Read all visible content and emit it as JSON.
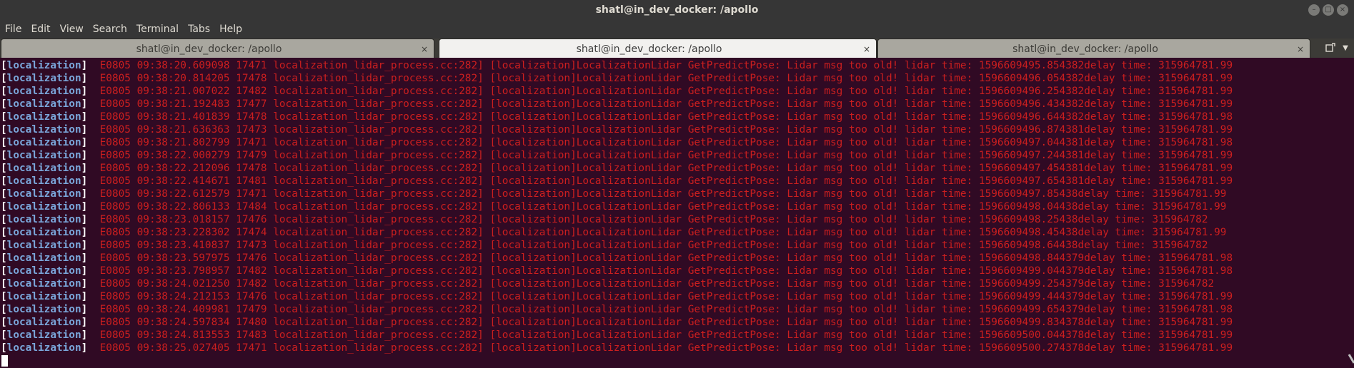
{
  "window": {
    "title": "shatl@in_dev_docker: /apollo",
    "buttons": [
      "minimize-button",
      "maximize-button",
      "close-button"
    ]
  },
  "menu": [
    "File",
    "Edit",
    "View",
    "Search",
    "Terminal",
    "Tabs",
    "Help"
  ],
  "tabs": [
    {
      "label": "shatl@in_dev_docker: /apollo",
      "close": "×",
      "active": false
    },
    {
      "label": "shatl@in_dev_docker: /apollo",
      "close": "×",
      "active": true
    },
    {
      "label": "shatl@in_dev_docker: /apollo",
      "close": "×",
      "active": false
    }
  ],
  "terminal": {
    "tag": "localization",
    "lines": [
      "E0805 09:38:20.609098 17471 localization_lidar_process.cc:282] [localization]LocalizationLidar GetPredictPose: Lidar msg too old! lidar time: 1596609495.854382delay time: 315964781.99",
      "E0805 09:38:20.814205 17478 localization_lidar_process.cc:282] [localization]LocalizationLidar GetPredictPose: Lidar msg too old! lidar time: 1596609496.054382delay time: 315964781.99",
      "E0805 09:38:21.007022 17482 localization_lidar_process.cc:282] [localization]LocalizationLidar GetPredictPose: Lidar msg too old! lidar time: 1596609496.254382delay time: 315964781.99",
      "E0805 09:38:21.192483 17477 localization_lidar_process.cc:282] [localization]LocalizationLidar GetPredictPose: Lidar msg too old! lidar time: 1596609496.434382delay time: 315964781.99",
      "E0805 09:38:21.401839 17478 localization_lidar_process.cc:282] [localization]LocalizationLidar GetPredictPose: Lidar msg too old! lidar time: 1596609496.644382delay time: 315964781.98",
      "E0805 09:38:21.636363 17473 localization_lidar_process.cc:282] [localization]LocalizationLidar GetPredictPose: Lidar msg too old! lidar time: 1596609496.874381delay time: 315964781.99",
      "E0805 09:38:21.802799 17471 localization_lidar_process.cc:282] [localization]LocalizationLidar GetPredictPose: Lidar msg too old! lidar time: 1596609497.044381delay time: 315964781.98",
      "E0805 09:38:22.000279 17479 localization_lidar_process.cc:282] [localization]LocalizationLidar GetPredictPose: Lidar msg too old! lidar time: 1596609497.244381delay time: 315964781.99",
      "E0805 09:38:22.212096 17478 localization_lidar_process.cc:282] [localization]LocalizationLidar GetPredictPose: Lidar msg too old! lidar time: 1596609497.454381delay time: 315964781.99",
      "E0805 09:38:22.414671 17481 localization_lidar_process.cc:282] [localization]LocalizationLidar GetPredictPose: Lidar msg too old! lidar time: 1596609497.654381delay time: 315964781.99",
      "E0805 09:38:22.612579 17471 localization_lidar_process.cc:282] [localization]LocalizationLidar GetPredictPose: Lidar msg too old! lidar time: 1596609497.85438delay time: 315964781.99",
      "E0805 09:38:22.806133 17484 localization_lidar_process.cc:282] [localization]LocalizationLidar GetPredictPose: Lidar msg too old! lidar time: 1596609498.04438delay time: 315964781.99",
      "E0805 09:38:23.018157 17476 localization_lidar_process.cc:282] [localization]LocalizationLidar GetPredictPose: Lidar msg too old! lidar time: 1596609498.25438delay time: 315964782",
      "E0805 09:38:23.228302 17474 localization_lidar_process.cc:282] [localization]LocalizationLidar GetPredictPose: Lidar msg too old! lidar time: 1596609498.45438delay time: 315964781.99",
      "E0805 09:38:23.410837 17473 localization_lidar_process.cc:282] [localization]LocalizationLidar GetPredictPose: Lidar msg too old! lidar time: 1596609498.64438delay time: 315964782",
      "E0805 09:38:23.597975 17476 localization_lidar_process.cc:282] [localization]LocalizationLidar GetPredictPose: Lidar msg too old! lidar time: 1596609498.844379delay time: 315964781.98",
      "E0805 09:38:23.798957 17482 localization_lidar_process.cc:282] [localization]LocalizationLidar GetPredictPose: Lidar msg too old! lidar time: 1596609499.044379delay time: 315964781.98",
      "E0805 09:38:24.021250 17482 localization_lidar_process.cc:282] [localization]LocalizationLidar GetPredictPose: Lidar msg too old! lidar time: 1596609499.254379delay time: 315964782",
      "E0805 09:38:24.212153 17476 localization_lidar_process.cc:282] [localization]LocalizationLidar GetPredictPose: Lidar msg too old! lidar time: 1596609499.444379delay time: 315964781.99",
      "E0805 09:38:24.409981 17479 localization_lidar_process.cc:282] [localization]LocalizationLidar GetPredictPose: Lidar msg too old! lidar time: 1596609499.654379delay time: 315964781.98",
      "E0805 09:38:24.597834 17480 localization_lidar_process.cc:282] [localization]LocalizationLidar GetPredictPose: Lidar msg too old! lidar time: 1596609499.834378delay time: 315964781.99",
      "E0805 09:38:24.813553 17483 localization_lidar_process.cc:282] [localization]LocalizationLidar GetPredictPose: Lidar msg too old! lidar time: 1596609500.044378delay time: 315964781.99",
      "E0805 09:38:25.027405 17471 localization_lidar_process.cc:282] [localization]LocalizationLidar GetPredictPose: Lidar msg too old! lidar time: 1596609500.274378delay time: 315964781.99"
    ]
  },
  "colors": {
    "terminal_bg": "#300a24",
    "error_text": "#cc1f1f",
    "tag_text": "#7aa6da",
    "bracket_text": "#ffffff",
    "titlebar_bg": "#363636"
  },
  "icons": {
    "new_tab": "new-tab-icon",
    "tab_menu": "chevron-down-icon"
  }
}
